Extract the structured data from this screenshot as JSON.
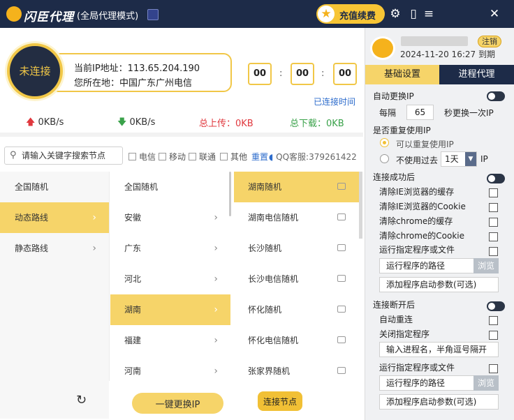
{
  "titlebar": {
    "app_name": "闪臣代理",
    "mode": "(全局代理模式)",
    "recharge_label": "充值续费",
    "icons": [
      "star-icon",
      "settings-icon",
      "phone-icon",
      "menu-icon",
      "close-icon"
    ]
  },
  "status": {
    "state": "未连接",
    "ip_line": "当前IP地址：113.65.204.190",
    "location_line": "您所在地：中国广东广州电信",
    "timer": [
      "00",
      "00",
      "00"
    ],
    "timer_sep": ":",
    "connected_time_label": "已连接时间"
  },
  "speed": {
    "up": "0KB/s",
    "down": "0KB/s",
    "total_up": "总上传：0KB",
    "total_down": "总下载：0KB"
  },
  "search": {
    "placeholder": "请输入关键字搜索节点",
    "isps": [
      "电信",
      "移动",
      "联通",
      "其他"
    ],
    "reset": "重置",
    "qq": "QQ客服:379261422"
  },
  "col1": [
    "全国随机",
    "动态路线",
    "静态路线"
  ],
  "col2": [
    "全国随机",
    "安徽",
    "广东",
    "河北",
    "湖南",
    "福建",
    "河南"
  ],
  "col3": [
    "湖南随机",
    "湖南电信随机",
    "长沙随机",
    "长沙电信随机",
    "怀化随机",
    "怀化电信随机",
    "张家界随机"
  ],
  "actions": {
    "change_ip": "一键更换IP",
    "connect_node": "连接节点"
  },
  "account": {
    "logout": "注销",
    "expire": "2024-11-20 16:27 到期"
  },
  "tabs": {
    "basic": "基础设置",
    "process": "进程代理"
  },
  "settings": {
    "auto_change_ip": "自动更换IP",
    "every": "每隔",
    "interval": "65",
    "interval_suffix": "秒更换一次IP",
    "reuse_title": "是否重复使用IP",
    "reuse_yes": "可以重复使用IP",
    "reuse_no_prefix": "不使用过去",
    "reuse_days": "1天",
    "reuse_no_suffix": "IP",
    "on_connect_title": "连接成功后",
    "clear_ie_cache": "清除IE浏览器的缓存",
    "clear_ie_cookie": "清除IE浏览器的Cookie",
    "clear_chrome_cache": "清除chrome的缓存",
    "clear_chrome_cookie": "清除chrome的Cookie",
    "run_program": "运行指定程序或文件",
    "program_path": "运行程序的路径",
    "browse": "浏览",
    "program_args": "添加程序启动参数(可选)",
    "on_disconnect_title": "连接断开后",
    "auto_reconnect": "自动重连",
    "close_program": "关闭指定程序",
    "process_names": "输入进程名，半角逗号隔开",
    "run_program2": "运行指定程序或文件",
    "program_path2": "运行程序的路径",
    "browse2": "浏览",
    "program_args2": "添加程序启动参数(可选)"
  }
}
